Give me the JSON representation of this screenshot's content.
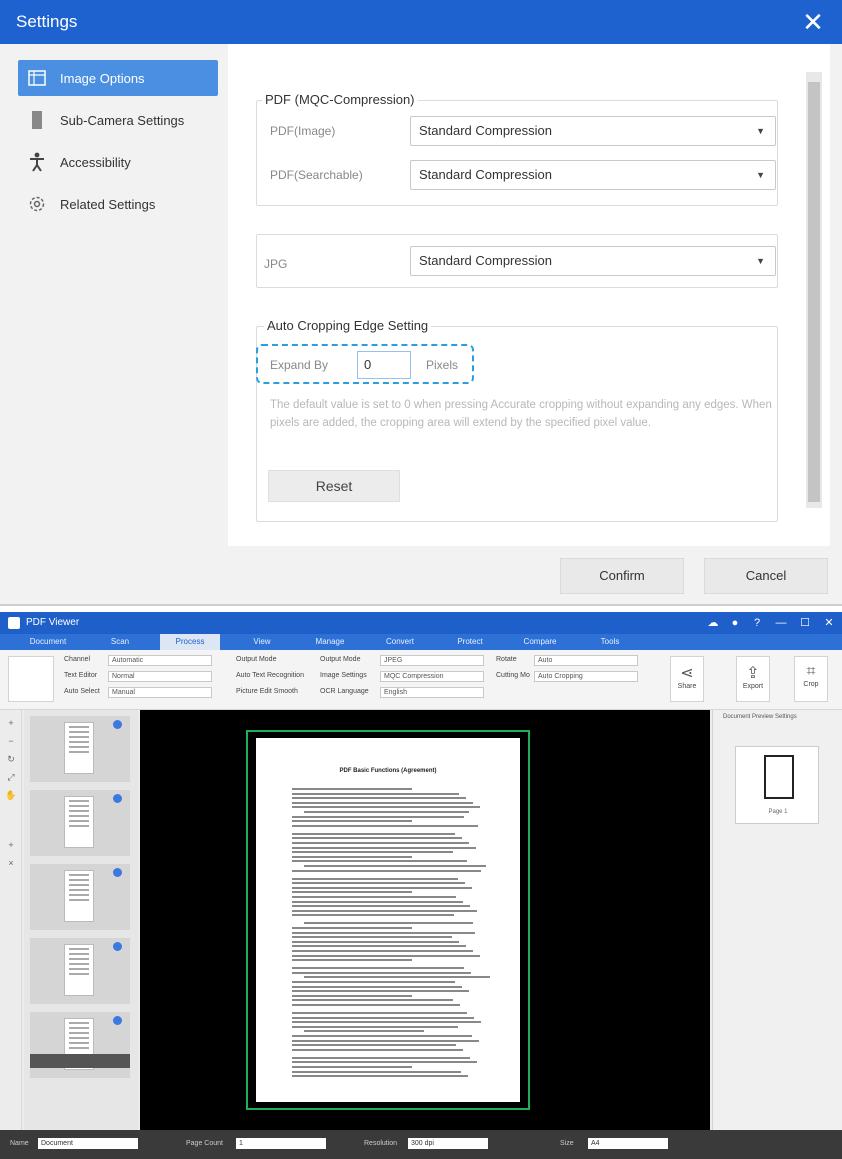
{
  "dialog": {
    "title": "Settings",
    "close_icon": "close-icon",
    "sidebar": {
      "items": [
        {
          "label": "Image Options",
          "icon": "image-options-icon",
          "active": true
        },
        {
          "label": "Sub-Camera Settings",
          "icon": "camera-icon",
          "active": false
        },
        {
          "label": "Accessibility",
          "icon": "accessibility-icon",
          "active": false
        },
        {
          "label": "Related Settings",
          "icon": "settings-icon",
          "active": false
        }
      ]
    },
    "pdf_group": {
      "title": "PDF (MQC-Compression)",
      "image_label": "PDF(Image)",
      "image_value": "Standard Compression",
      "searchable_label": "PDF(Searchable)",
      "searchable_value": "Standard Compression"
    },
    "jpg_group": {
      "label": "JPG",
      "value": "Standard Compression"
    },
    "crop_group": {
      "title": "Auto Cropping Edge Setting",
      "expand_label": "Expand By",
      "expand_value": "0",
      "unit": "Pixels",
      "hint": "The default value is set to 0 when pressing Accurate cropping without expanding any edges. When pixels are added, the cropping area will extend by the specified pixel value.",
      "reset_label": "Reset"
    },
    "confirm_label": "Confirm",
    "cancel_label": "Cancel",
    "accent_color": "#1e62d0",
    "highlight_color": "#2a9ee0"
  },
  "app": {
    "title": "PDF Viewer",
    "tabs": [
      "Document",
      "Scan",
      "Process",
      "View",
      "Manage",
      "Convert",
      "Protect",
      "Compare",
      "Tools"
    ],
    "active_tab": "Process",
    "ribbon": {
      "fields": [
        {
          "label": "Channel",
          "value": "Automatic"
        },
        {
          "label": "Text Editor",
          "value": "Normal"
        },
        {
          "label": "Auto Select",
          "value": "Manual"
        },
        {
          "label": "Output Mode",
          "value": "JPEG"
        },
        {
          "label": "Image Settings",
          "value": "MQC Compression"
        },
        {
          "label": "OCR Language",
          "value": "English"
        },
        {
          "label": "Rotate",
          "value": "Auto"
        },
        {
          "label": "Cutting Mo",
          "value": "Auto Cropping"
        }
      ],
      "left_labels": [
        "Output Mode",
        "Auto Text Recognition",
        "Picture Edit Smooth"
      ],
      "buttons": [
        {
          "label": "Share",
          "icon": "share-icon"
        },
        {
          "label": "Export",
          "icon": "export-icon"
        },
        {
          "label": "Crop",
          "icon": "crop-icon"
        }
      ]
    },
    "document": {
      "heading": "PDF Basic Functions (Agreement)"
    },
    "right_panel": {
      "label": "Document Preview Settings",
      "thumb_caption": "Page 1"
    },
    "status": {
      "fields": [
        {
          "label": "Name",
          "value": "Document"
        },
        {
          "label": "Page Count",
          "value": "1"
        },
        {
          "label": "Resolution",
          "value": "300 dpi"
        },
        {
          "label": "Size",
          "value": "A4"
        }
      ]
    }
  }
}
